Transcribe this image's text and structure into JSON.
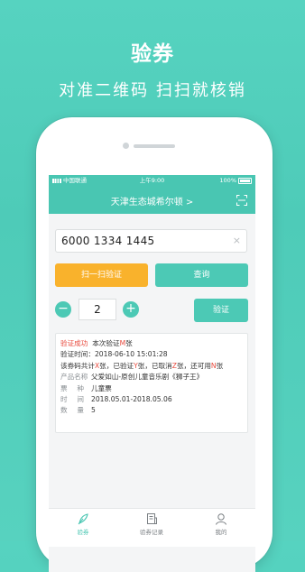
{
  "hero": {
    "title": "验券",
    "subtitle": "对准二维码   扫扫就核销"
  },
  "status_bar": {
    "carrier": "中国联通",
    "time": "上午9:00",
    "battery": "100%"
  },
  "nav": {
    "title": "天津生态城希尔顿 >",
    "right_icon": "scan-icon"
  },
  "code_input": {
    "value": "6000 1334 1445",
    "clear_icon": "×"
  },
  "buttons": {
    "scan": "扫一扫验证",
    "query": "查询",
    "verify": "验证"
  },
  "stepper": {
    "minus": "−",
    "value": "2",
    "plus": "+"
  },
  "result": {
    "line1_status": "验证成功",
    "line1_a": "本次验证",
    "line1_m": "M",
    "line1_b": "张",
    "line2": "验证时间：2018-06-10 15:01:28",
    "line3_a": "该券码共计",
    "line3_x": "X",
    "line3_b": "张，已验证",
    "line3_y": "Y",
    "line3_c": "张，已取消",
    "line3_z": "Z",
    "line3_d": "张，还可用",
    "line3_n": "N",
    "line3_e": "张",
    "product_key": "产品名称",
    "product_value": "父爱如山-原创儿童音乐剧《狮子王》",
    "type_key": "票种",
    "type_value": "儿童票",
    "time_key": "时间",
    "time_value": "2018.05.01-2018.05.06",
    "qty_key": "数量",
    "qty_value": "5"
  },
  "tabs": [
    {
      "label": "验券",
      "icon": "feather-icon",
      "active": true
    },
    {
      "label": "验券记录",
      "icon": "record-icon",
      "active": false
    },
    {
      "label": "我的",
      "icon": "user-icon",
      "active": false
    }
  ],
  "colors": {
    "brand": "#49c6b2",
    "accent_orange": "#f9b22c",
    "alert_red": "#e84a3d"
  }
}
